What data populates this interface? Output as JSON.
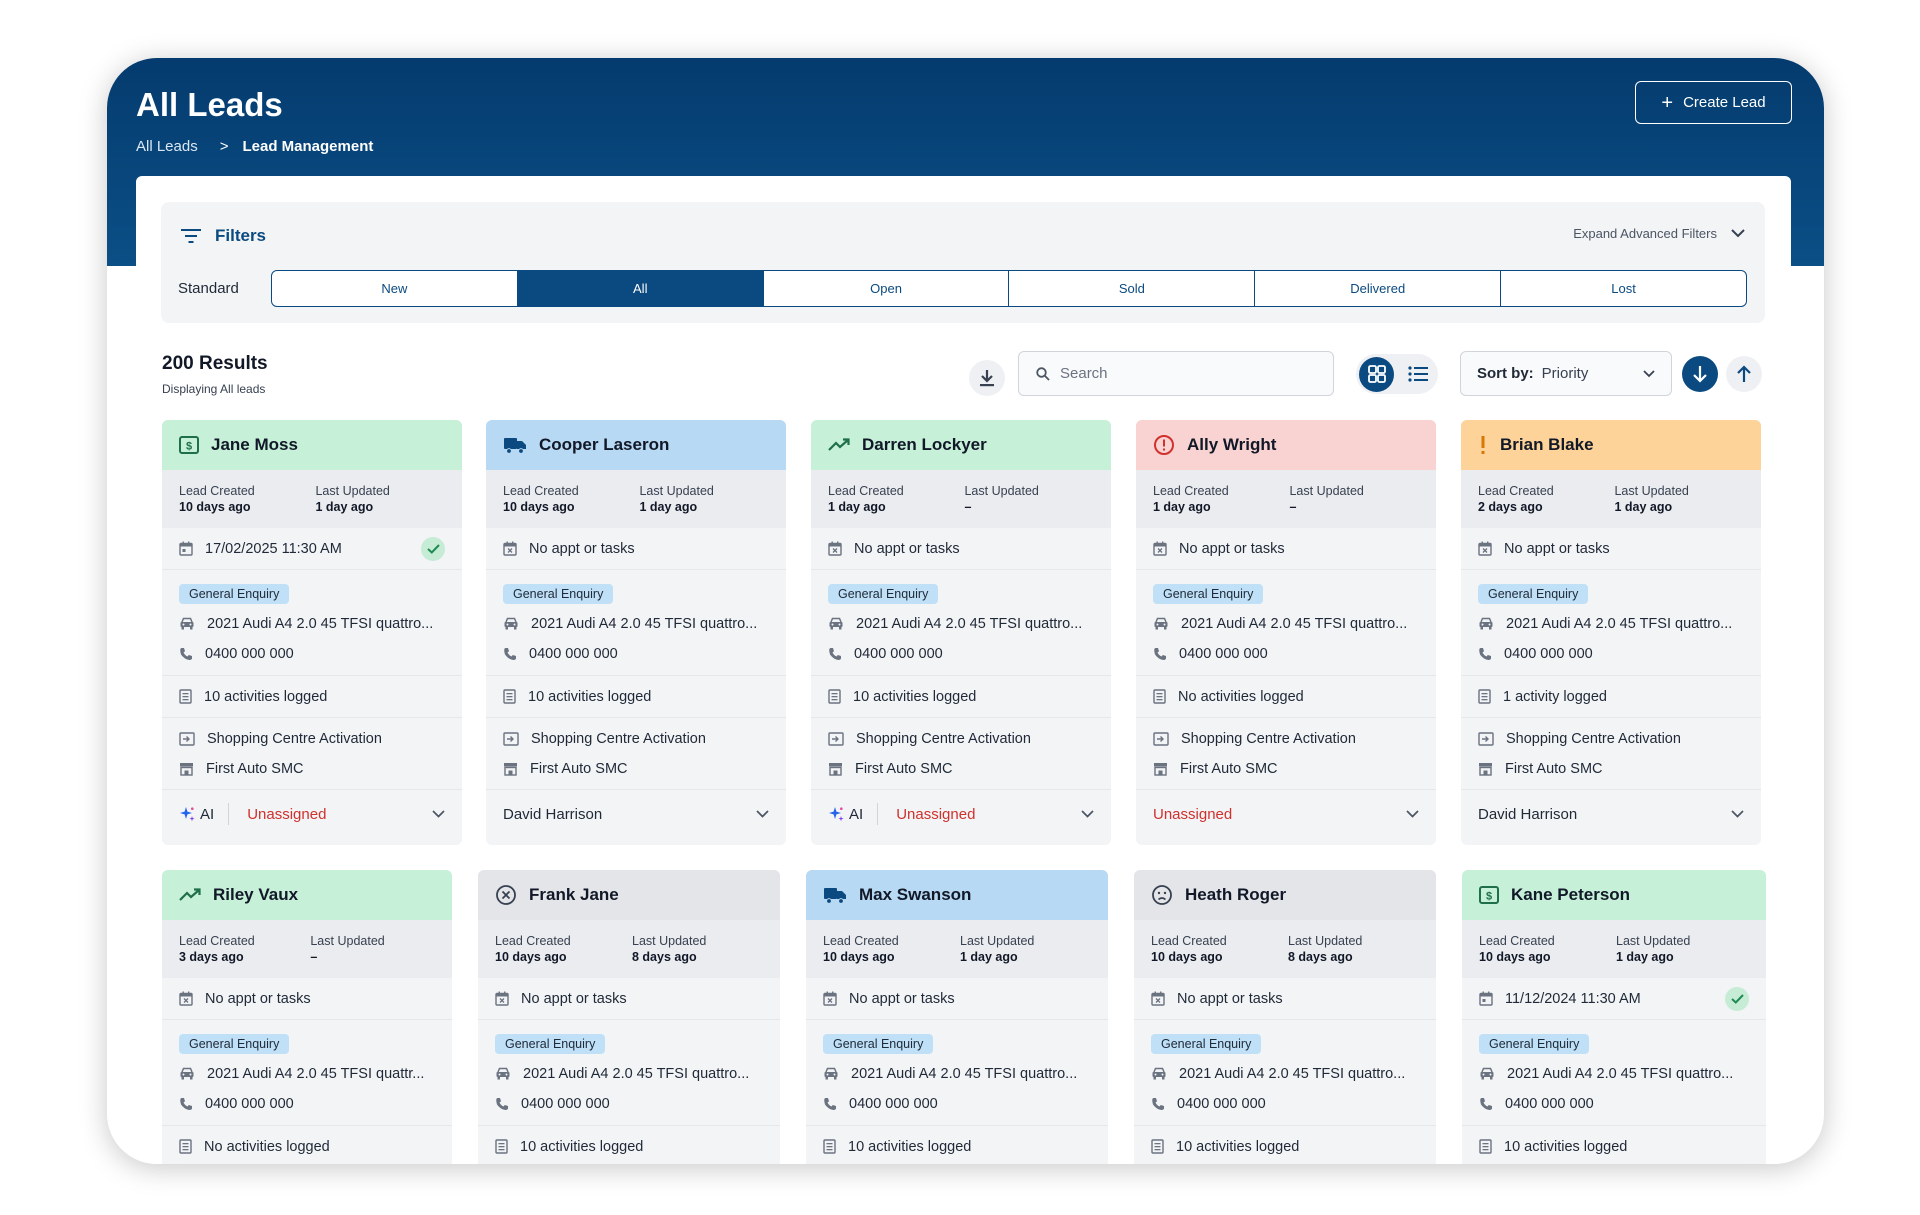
{
  "header": {
    "title": "All Leads",
    "breadcrumb_root": "All Leads",
    "breadcrumb_separator": ">",
    "breadcrumb_current": "Lead Management",
    "create_label": "Create Lead"
  },
  "filters": {
    "title": "Filters",
    "advanced_label": "Expand Advanced Filters",
    "standard_label": "Standard",
    "segments": [
      {
        "label": "New",
        "active": false
      },
      {
        "label": "All",
        "active": true
      },
      {
        "label": "Open",
        "active": false
      },
      {
        "label": "Sold",
        "active": false
      },
      {
        "label": "Delivered",
        "active": false
      },
      {
        "label": "Lost",
        "active": false
      }
    ]
  },
  "results": {
    "count_label": "200 Results",
    "sub_label": "Displaying All leads",
    "search_placeholder": "Search",
    "sort_label": "Sort by:",
    "sort_value": "Priority",
    "view_mode": "grid"
  },
  "labels": {
    "lead_created": "Lead Created",
    "last_updated": "Last Updated",
    "ai": "AI"
  },
  "colors": {
    "brand": "#0b4a80",
    "green": "#c6f0d8",
    "blue": "#b8d9f3",
    "red": "#f9d2d2",
    "orange": "#fdd399",
    "grey": "#e4e5e8",
    "unassigned": "#d0312d"
  },
  "cards": [
    {
      "name": "Jane Moss",
      "icon": "dollar-icon",
      "color": "green",
      "lead_created": "10 days ago",
      "last_updated": "1 day ago",
      "appt": "17/02/2025  11:30 AM",
      "appt_done": true,
      "enquiry": "General Enquiry",
      "vehicle": "2021 Audi A4 2.0 45 TFSI quattro...",
      "phone": "0400 000 000",
      "activities": "10 activities logged",
      "source": "Shopping Centre Activation",
      "dealer": "First Auto SMC",
      "ai": true,
      "assignee": "Unassigned"
    },
    {
      "name": "Cooper Laseron",
      "icon": "truck-icon",
      "color": "blue",
      "lead_created": "10 days ago",
      "last_updated": "1 day ago",
      "appt": "No appt or tasks",
      "appt_done": false,
      "enquiry": "General Enquiry",
      "vehicle": "2021 Audi A4 2.0 45 TFSI quattro...",
      "phone": "0400 000 000",
      "activities": "10 activities logged",
      "source": "Shopping Centre Activation",
      "dealer": "First Auto SMC",
      "ai": false,
      "assignee": "David Harrison"
    },
    {
      "name": "Darren Lockyer",
      "icon": "trending-up-icon",
      "color": "green",
      "lead_created": "1 day ago",
      "last_updated": "–",
      "appt": "No appt or tasks",
      "appt_done": false,
      "enquiry": "General Enquiry",
      "vehicle": "2021 Audi A4 2.0 45 TFSI quattro...",
      "phone": "0400 000 000",
      "activities": "10 activities logged",
      "source": "Shopping Centre Activation",
      "dealer": "First Auto SMC",
      "ai": true,
      "assignee": "Unassigned"
    },
    {
      "name": "Ally Wright",
      "icon": "alert-circle-icon",
      "color": "red",
      "lead_created": "1 day ago",
      "last_updated": "–",
      "appt": "No appt or tasks",
      "appt_done": false,
      "enquiry": "General Enquiry",
      "vehicle": "2021 Audi A4 2.0 45 TFSI quattro...",
      "phone": "0400 000 000",
      "activities": "No activities logged",
      "source": "Shopping Centre Activation",
      "dealer": "First Auto SMC",
      "ai": false,
      "assignee": "Unassigned"
    },
    {
      "name": "Brian Blake",
      "icon": "exclamation-icon",
      "color": "orange",
      "lead_created": "2 days ago",
      "last_updated": "1 day ago",
      "appt": "No appt or tasks",
      "appt_done": false,
      "enquiry": "General Enquiry",
      "vehicle": "2021 Audi A4 2.0 45 TFSI quattro...",
      "phone": "0400 000 000",
      "activities": "1 activity logged",
      "source": "Shopping Centre Activation",
      "dealer": "First Auto SMC",
      "ai": false,
      "assignee": "David Harrison"
    },
    {
      "name": "Riley Vaux",
      "icon": "trending-up-icon",
      "color": "green",
      "lead_created": "3 days ago",
      "last_updated": "–",
      "appt": "No appt or tasks",
      "appt_done": false,
      "enquiry": "General Enquiry",
      "vehicle": "2021 Audi A4 2.0 45 TFSI quattr...",
      "phone": "0400 000 000",
      "activities": "No activities logged",
      "source": "",
      "dealer": "",
      "ai": false,
      "assignee": ""
    },
    {
      "name": "Frank Jane",
      "icon": "x-circle-icon",
      "color": "grey",
      "lead_created": "10 days ago",
      "last_updated": "8 days ago",
      "appt": "No appt or tasks",
      "appt_done": false,
      "enquiry": "General Enquiry",
      "vehicle": "2021 Audi A4 2.0 45 TFSI quattro...",
      "phone": "0400 000 000",
      "activities": "10 activities logged",
      "source": "",
      "dealer": "",
      "ai": false,
      "assignee": ""
    },
    {
      "name": "Max Swanson",
      "icon": "truck-icon",
      "color": "blue",
      "lead_created": "10 days ago",
      "last_updated": "1 day ago",
      "appt": "No appt or tasks",
      "appt_done": false,
      "enquiry": "General Enquiry",
      "vehicle": "2021 Audi A4 2.0 45 TFSI quattro...",
      "phone": "0400 000 000",
      "activities": "10 activities logged",
      "source": "",
      "dealer": "",
      "ai": false,
      "assignee": ""
    },
    {
      "name": "Heath Roger",
      "icon": "sad-face-icon",
      "color": "grey",
      "lead_created": "10 days ago",
      "last_updated": "8 days ago",
      "appt": "No appt or tasks",
      "appt_done": false,
      "enquiry": "General Enquiry",
      "vehicle": "2021 Audi A4 2.0 45 TFSI quattro...",
      "phone": "0400 000 000",
      "activities": "10 activities logged",
      "source": "",
      "dealer": "",
      "ai": false,
      "assignee": ""
    },
    {
      "name": "Kane Peterson",
      "icon": "dollar-icon",
      "color": "green",
      "lead_created": "10 days ago",
      "last_updated": "1 day ago",
      "appt": "11/12/2024  11:30 AM",
      "appt_done": true,
      "enquiry": "General Enquiry",
      "vehicle": "2021 Audi A4 2.0 45 TFSI quattro...",
      "phone": "0400 000 000",
      "activities": "10 activities logged",
      "source": "",
      "dealer": "",
      "ai": false,
      "assignee": ""
    }
  ]
}
